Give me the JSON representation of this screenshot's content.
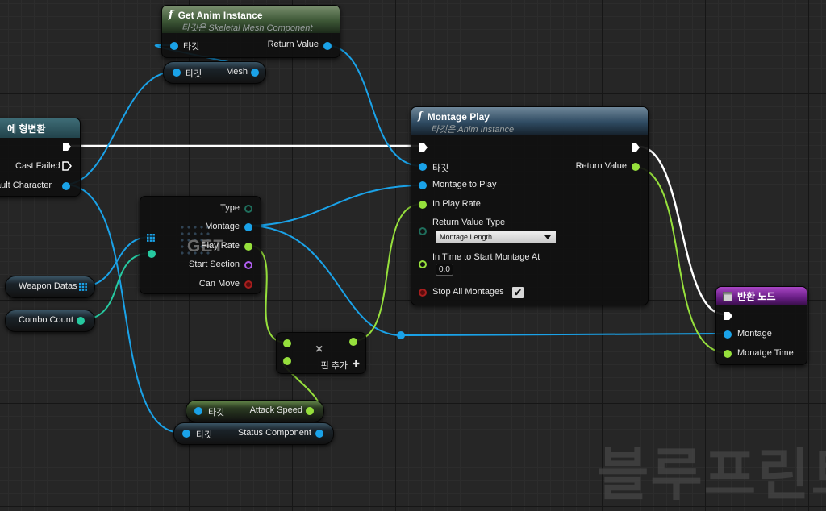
{
  "nodes": {
    "get_anim_instance": {
      "title": "Get Anim Instance",
      "subtitle": "타깃은 Skeletal Mesh Component",
      "target": "타깃",
      "return_value": "Return Value"
    },
    "get_mesh": {
      "target": "타깃",
      "output": "Mesh"
    },
    "cast": {
      "title": "에 형변환",
      "cast_failed": "Cast Failed",
      "output": "ault Character"
    },
    "get_array": {
      "type": "Type",
      "montage": "Montage",
      "play_rate": "Play Rate",
      "start_section": "Start Section",
      "can_move": "Can Move",
      "label": "GET"
    },
    "weapon_datas": {
      "label": "Weapon Datas"
    },
    "combo_count": {
      "label": "Combo Count"
    },
    "montage_play": {
      "title": "Montage Play",
      "subtitle": "타깃은 Anim Instance",
      "target": "타깃",
      "montage_to_play": "Montage to Play",
      "in_play_rate": "In Play Rate",
      "return_value_type": "Return Value Type",
      "return_value_type_selected": "Montage Length",
      "in_time_to_start": "In Time to Start Montage At",
      "in_time_value": "0.0",
      "stop_all": "Stop All Montages",
      "stop_all_checked": "✔",
      "return_value": "Return Value"
    },
    "multiply": {
      "symbol": "×",
      "add_pin": "핀 추가",
      "plus": "✚"
    },
    "attack_speed": {
      "target": "타깃",
      "output": "Attack Speed"
    },
    "status_component": {
      "target": "타깃",
      "output": "Status Component"
    },
    "return_node": {
      "title": "반환 노드",
      "montage": "Montage",
      "montage_time": "Monatge Time"
    }
  },
  "watermark": "블루프린트",
  "colors": {
    "object": "#1aa2e8",
    "float": "#96e03c",
    "int": "#26c9a0",
    "exec": "#ffffff",
    "function_header": "#2f4b62",
    "pure_header": "#3d5736",
    "return_header": "#6a1e86"
  }
}
